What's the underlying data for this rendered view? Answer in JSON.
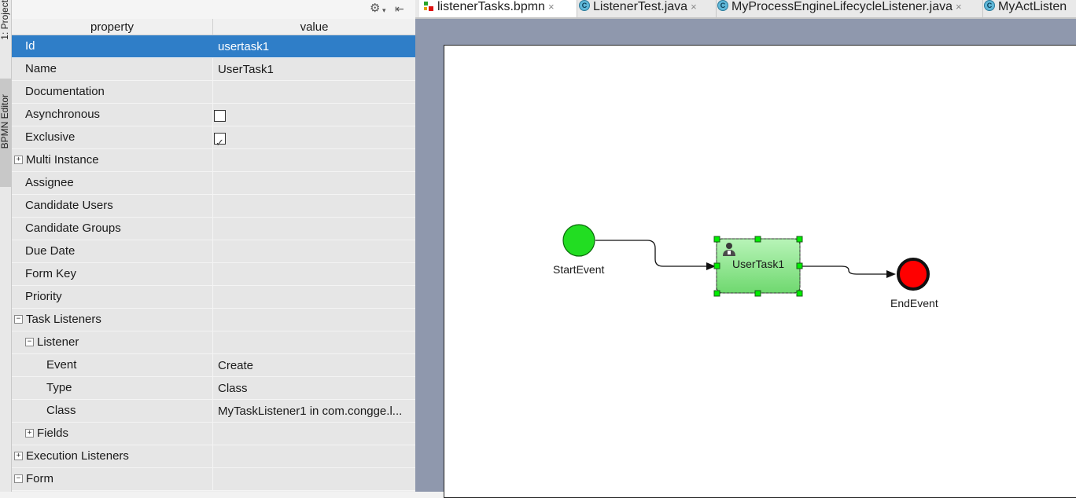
{
  "side_strip": {
    "project_tab": "1: Project",
    "bpmn_tab": "BPMN Editor"
  },
  "toolbar": {
    "gear_glyph": "⚙",
    "gear_caret": "▾",
    "pin_glyph": "⇤"
  },
  "columns": {
    "property": "property",
    "value": "value"
  },
  "properties": [
    {
      "label": "Id",
      "value": "usertask1",
      "selected": true
    },
    {
      "label": "Name",
      "value": "UserTask1"
    },
    {
      "label": "Documentation",
      "value": ""
    },
    {
      "label": "Asynchronous",
      "checkbox": false
    },
    {
      "label": "Exclusive",
      "checkbox": true
    },
    {
      "label": "Multi Instance",
      "toggle": "+"
    },
    {
      "label": "Assignee",
      "value": ""
    },
    {
      "label": "Candidate Users",
      "value": ""
    },
    {
      "label": "Candidate Groups",
      "value": ""
    },
    {
      "label": "Due Date",
      "value": ""
    },
    {
      "label": "Form Key",
      "value": ""
    },
    {
      "label": "Priority",
      "value": ""
    },
    {
      "label": "Task Listeners",
      "toggle": "−"
    },
    {
      "label": "Listener",
      "toggle": "−",
      "indent": 1
    },
    {
      "label": "Event",
      "value": "Create",
      "indent": 2
    },
    {
      "label": "Type",
      "value": "Class",
      "indent": 2
    },
    {
      "label": "Class",
      "value": "MyTaskListener1 in com.congge.l...",
      "indent": 2
    },
    {
      "label": "Fields",
      "toggle": "+",
      "indent": 1
    },
    {
      "label": "Execution Listeners",
      "toggle": "+"
    },
    {
      "label": "Form",
      "toggle": "−"
    }
  ],
  "tabs": [
    {
      "label": "listenerTasks.bpmn",
      "icon": "bpmn-file-icon",
      "active": true
    },
    {
      "label": "ListenerTest.java",
      "icon": "java-class-icon"
    },
    {
      "label": "MyProcessEngineLifecycleListener.java",
      "icon": "java-class-icon"
    },
    {
      "label": "MyActListen",
      "icon": "java-class-icon"
    }
  ],
  "tab_close_glyph": "×",
  "java_icon_letter": "C",
  "diagram": {
    "start_event": "StartEvent",
    "user_task": "UserTask1",
    "end_event": "EndEvent"
  },
  "colors": {
    "selection": "#2f7ec8",
    "start_event_fill": "#22dd22",
    "end_event_fill": "#ff0000",
    "task_fill": "#90e890",
    "handle": "#00ee00",
    "canvas_bg": "#8f98ad"
  }
}
